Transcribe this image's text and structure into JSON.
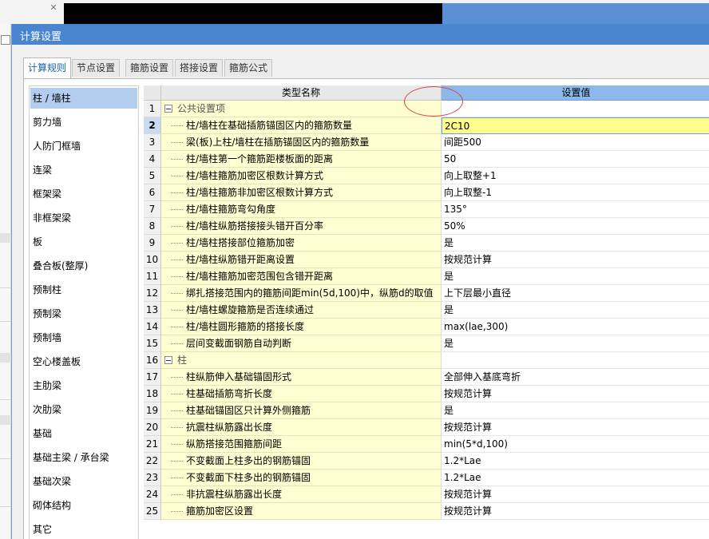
{
  "dialog": {
    "title": "计算设置"
  },
  "tabs": [
    {
      "label": "计算规则",
      "active": true
    },
    {
      "label": "节点设置"
    },
    {
      "label": "箍筋设置"
    },
    {
      "label": "搭接设置"
    },
    {
      "label": "箍筋公式"
    }
  ],
  "categories": [
    "柱 / 墙柱",
    "剪力墙",
    "人防门框墙",
    "连梁",
    "框架梁",
    "非框架梁",
    "板",
    "叠合板(整厚)",
    "预制柱",
    "预制梁",
    "预制墙",
    "空心楼盖板",
    "主肋梁",
    "次肋梁",
    "基础",
    "基础主梁 / 承台梁",
    "基础次梁",
    "砌体结构",
    "其它"
  ],
  "grid": {
    "header_name": "类型名称",
    "header_value": "设置值",
    "rows": [
      {
        "n": "1",
        "name": "公共设置项",
        "value": "",
        "group": true
      },
      {
        "n": "2",
        "name": "柱/墙柱在基础插筋锚固区内的箍筋数量",
        "value": "2C10",
        "current": true
      },
      {
        "n": "3",
        "name": "梁(板)上柱/墙柱在插筋锚固区内的箍筋数量",
        "value": "间距500"
      },
      {
        "n": "4",
        "name": "柱/墙柱第一个箍筋距楼板面的距离",
        "value": "50"
      },
      {
        "n": "5",
        "name": "柱/墙柱箍筋加密区根数计算方式",
        "value": "向上取整+1"
      },
      {
        "n": "6",
        "name": "柱/墙柱箍筋非加密区根数计算方式",
        "value": "向上取整-1"
      },
      {
        "n": "7",
        "name": "柱/墙柱箍筋弯勾角度",
        "value": "135°"
      },
      {
        "n": "8",
        "name": "柱/墙柱纵筋搭接接头错开百分率",
        "value": "50%"
      },
      {
        "n": "9",
        "name": "柱/墙柱搭接部位箍筋加密",
        "value": "是"
      },
      {
        "n": "10",
        "name": "柱/墙柱纵筋错开距离设置",
        "value": "按规范计算"
      },
      {
        "n": "11",
        "name": "柱/墙柱箍筋加密范围包含错开距离",
        "value": "是"
      },
      {
        "n": "12",
        "name": "绑扎搭接范围内的箍筋间距min(5d,100)中，纵筋d的取值",
        "value": "上下层最小直径"
      },
      {
        "n": "13",
        "name": "柱/墙柱螺旋箍筋是否连续通过",
        "value": "是"
      },
      {
        "n": "14",
        "name": "柱/墙柱圆形箍筋的搭接长度",
        "value": "max(lae,300)"
      },
      {
        "n": "15",
        "name": "层间变截面钢筋自动判断",
        "value": "是"
      },
      {
        "n": "16",
        "name": "柱",
        "value": "",
        "group": true
      },
      {
        "n": "17",
        "name": "柱纵筋伸入基础锚固形式",
        "value": "全部伸入基底弯折"
      },
      {
        "n": "18",
        "name": "柱基础插筋弯折长度",
        "value": "按规范计算"
      },
      {
        "n": "19",
        "name": "柱基础锚固区只计算外侧箍筋",
        "value": "是"
      },
      {
        "n": "20",
        "name": "抗震柱纵筋露出长度",
        "value": "按规范计算"
      },
      {
        "n": "21",
        "name": "纵筋搭接范围箍筋间距",
        "value": "min(5*d,100)"
      },
      {
        "n": "22",
        "name": "不变截面上柱多出的钢筋锚固",
        "value": "1.2*Lae"
      },
      {
        "n": "23",
        "name": "不变截面下柱多出的钢筋锚固",
        "value": "1.2*Lae"
      },
      {
        "n": "24",
        "name": "非抗震柱纵筋露出长度",
        "value": "按规范计算"
      },
      {
        "n": "25",
        "name": "箍筋加密区设置",
        "value": "按规范计算"
      }
    ]
  },
  "colors": {
    "title_bar": "#4a86cf",
    "selected_category": "#b3cdef",
    "name_column": "#fffed0",
    "current_value": "#fffe8c",
    "annotation": "#d24444"
  }
}
